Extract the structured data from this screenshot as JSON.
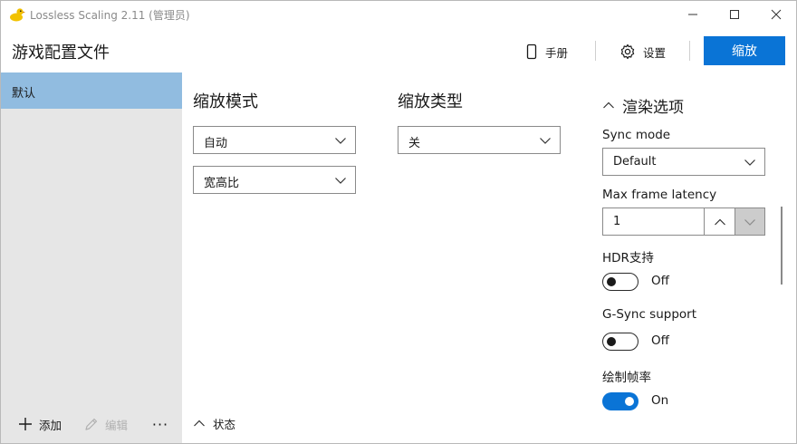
{
  "window": {
    "title": "Lossless Scaling 2.11 (管理员)",
    "icon": "duck-logo-icon",
    "controls": [
      "minimize-icon",
      "maximize-icon",
      "close-icon"
    ]
  },
  "header": {
    "page_title": "游戏配置文件",
    "manual_label": "手册",
    "settings_label": "设置",
    "scale_button": "缩放",
    "accent_color": "#0a74d6"
  },
  "sidebar": {
    "profiles": [
      {
        "label": "默认",
        "selected": true
      }
    ],
    "selected_color": "#91bce0",
    "add_label": "添加",
    "edit_label": "编辑",
    "more_label": "···"
  },
  "main": {
    "scaling_mode": {
      "title": "缩放模式",
      "mode_value": "自动",
      "aspect_value": "宽高比"
    },
    "scaling_type": {
      "title": "缩放类型",
      "value": "关"
    },
    "status_label": "状态"
  },
  "render_options": {
    "title": "渲染选项",
    "sync_mode": {
      "label": "Sync mode",
      "value": "Default"
    },
    "max_frame_latency": {
      "label": "Max frame latency",
      "value": "1"
    },
    "hdr": {
      "label": "HDR支持",
      "state": "Off",
      "on": false
    },
    "gsync": {
      "label": "G-Sync support",
      "state": "Off",
      "on": false
    },
    "draw_fps": {
      "label": "绘制帧率",
      "state": "On",
      "on": true
    }
  }
}
